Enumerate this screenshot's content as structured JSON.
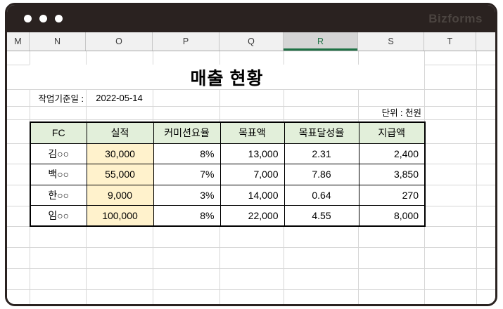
{
  "titlebar": {
    "brand": "Bizforms"
  },
  "column_headers": [
    "M",
    "N",
    "O",
    "P",
    "Q",
    "R",
    "S",
    "T"
  ],
  "selected_column": "R",
  "sheet": {
    "title": "매출 현황",
    "date_label": "작업기준일 :",
    "date_value": "2022-05-14",
    "unit_label": "단위 : 천원"
  },
  "table": {
    "headers": [
      "FC",
      "실적",
      "커미션요율",
      "목표액",
      "목표달성율",
      "지급액"
    ],
    "rows": [
      [
        "김○○",
        "30,000",
        "8%",
        "13,000",
        "2.31",
        "2,400"
      ],
      [
        "백○○",
        "55,000",
        "7%",
        "7,000",
        "7.86",
        "3,850"
      ],
      [
        "한○○",
        "9,000",
        "3%",
        "14,000",
        "0.64",
        "270"
      ],
      [
        "임○○",
        "100,000",
        "8%",
        "22,000",
        "4.55",
        "8,000"
      ]
    ]
  },
  "colors": {
    "titlebar_bg": "#2a2220",
    "accent_green": "#1e7145",
    "header_fill": "#e2efda",
    "performance_fill": "#fff2cc",
    "selected_column_bg": "#d5d5d5",
    "gridline": "#d6d6d6"
  }
}
